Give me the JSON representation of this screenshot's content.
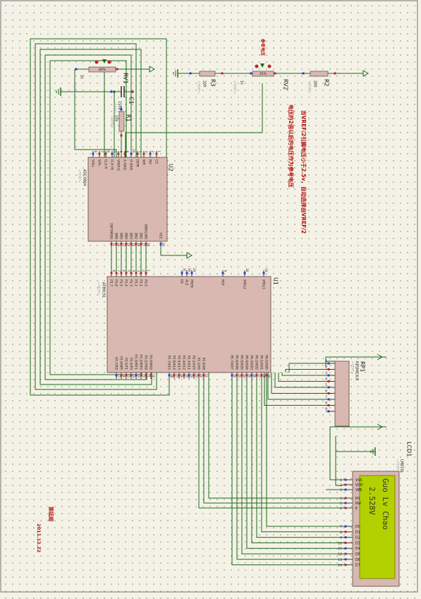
{
  "colors": {
    "wire": "#1a6b1a",
    "body": "#d8b8b0",
    "pin": "#c0242a",
    "pin_blue": "#2a3fd8",
    "text": "#1a1a1a",
    "grey": "#9a9a9a",
    "red_text": "#b01010",
    "lcd_bg": "#b3d000",
    "lcd_text": "#333333"
  },
  "u2": {
    "ref": "U2",
    "part": "ADC0804",
    "sub": "<TEXT>",
    "left_pins": [
      {
        "num": "6",
        "name": "VIN+"
      },
      {
        "num": "7",
        "name": "VIN-"
      },
      {
        "num": "19",
        "name": "CLK R"
      },
      {
        "num": "4",
        "name": "CLK IN"
      },
      {
        "num": "9",
        "name": "VREF/2"
      },
      {
        "num": "8",
        "name": "A GND"
      },
      {
        "num": "10",
        "name": "D GND"
      },
      {
        "num": "5",
        "name": "INTR"
      },
      {
        "num": "3",
        "name": "WR"
      },
      {
        "num": "2",
        "name": "RD"
      },
      {
        "num": "1",
        "name": "CS"
      }
    ],
    "right_pins": [
      {
        "num": "11",
        "name": "DB7(MSB)"
      },
      {
        "num": "12",
        "name": "DB6"
      },
      {
        "num": "13",
        "name": "DB5"
      },
      {
        "num": "14",
        "name": "DB4"
      },
      {
        "num": "15",
        "name": "DB3"
      },
      {
        "num": "16",
        "name": "DB2"
      },
      {
        "num": "17",
        "name": "DB1"
      },
      {
        "num": "18",
        "name": "DB0(LSB)"
      },
      {
        "num": "20",
        "name": "VCC"
      }
    ]
  },
  "u1": {
    "ref": "U1",
    "part": "AT89C51",
    "sub": "<TEXT>",
    "top_pins": [
      {
        "num": "8",
        "name": "P1.7"
      },
      {
        "num": "7",
        "name": "P1.6"
      },
      {
        "num": "6",
        "name": "P1.5"
      },
      {
        "num": "5",
        "name": "P1.4"
      },
      {
        "num": "4",
        "name": "P1.3"
      },
      {
        "num": "3",
        "name": "P1.2"
      },
      {
        "num": "2",
        "name": "P1.1"
      },
      {
        "num": "1",
        "name": "P1.0"
      },
      {
        "num": "31",
        "name": "EA"
      },
      {
        "num": "30",
        "name": "ALE"
      },
      {
        "num": "29",
        "name": "PSEN"
      },
      {
        "num": "9",
        "name": "RST"
      },
      {
        "num": "18",
        "name": "XTAL2"
      },
      {
        "num": "19",
        "name": "XTAL1"
      }
    ],
    "bottom_pins": [
      {
        "num": "17",
        "name": "P3.7/RD"
      },
      {
        "num": "16",
        "name": "P3.6/WR"
      },
      {
        "num": "15",
        "name": "P3.5/T1"
      },
      {
        "num": "14",
        "name": "P3.4/T0"
      },
      {
        "num": "13",
        "name": "P3.3/INT1"
      },
      {
        "num": "12",
        "name": "P3.2/INT0"
      },
      {
        "num": "11",
        "name": "P3.1/TXD"
      },
      {
        "num": "10",
        "name": "P3.0/RXD"
      },
      {
        "num": "28",
        "name": "P2.7/A15"
      },
      {
        "num": "27",
        "name": "P2.6/A14"
      },
      {
        "num": "26",
        "name": "P2.5/A13"
      },
      {
        "num": "25",
        "name": "P2.4/A12"
      },
      {
        "num": "24",
        "name": "P2.3/A11"
      },
      {
        "num": "23",
        "name": "P2.2/A10"
      },
      {
        "num": "22",
        "name": "P2.1/A9"
      },
      {
        "num": "21",
        "name": "P2.0/A8"
      },
      {
        "num": "32",
        "name": "P0.7/AD7"
      },
      {
        "num": "33",
        "name": "P0.6/AD6"
      },
      {
        "num": "34",
        "name": "P0.5/AD5"
      },
      {
        "num": "35",
        "name": "P0.4/AD4"
      },
      {
        "num": "36",
        "name": "P0.3/AD3"
      },
      {
        "num": "37",
        "name": "P0.2/AD2"
      },
      {
        "num": "38",
        "name": "P0.1/AD1"
      },
      {
        "num": "39",
        "name": "P0.0/AD0"
      }
    ]
  },
  "rp1": {
    "ref": "RP1",
    "part": "RESPACK-8",
    "sub": "<TEXT>",
    "pins": [
      "1",
      "2",
      "3",
      "4",
      "5",
      "6",
      "7",
      "8",
      "9"
    ]
  },
  "lcd1": {
    "ref": "LCD1",
    "part": "LM016L",
    "sub": "<TEXT>",
    "pins": [
      {
        "num": "1",
        "name": "VSS"
      },
      {
        "num": "2",
        "name": "VDD"
      },
      {
        "num": "3",
        "name": "VEE"
      },
      {
        "num": "4",
        "name": "RS"
      },
      {
        "num": "5",
        "name": "RW"
      },
      {
        "num": "6",
        "name": "E"
      },
      {
        "num": "7",
        "name": "D0"
      },
      {
        "num": "8",
        "name": "D1"
      },
      {
        "num": "9",
        "name": "D2"
      },
      {
        "num": "10",
        "name": "D3"
      },
      {
        "num": "11",
        "name": "D4"
      },
      {
        "num": "12",
        "name": "D5"
      },
      {
        "num": "13",
        "name": "D6"
      },
      {
        "num": "14",
        "name": "D7"
      }
    ],
    "line1": "Guo Lv Chao",
    "line2": "2.528V"
  },
  "rv1": {
    "ref": "RV1",
    "value": "1k",
    "sub": "<TEXT>",
    "percent": "80%"
  },
  "rv2": {
    "ref": "RV2",
    "value": "1k",
    "sub": "<TEXT>",
    "percent": "45%",
    "note": "参考电压"
  },
  "r1": {
    "ref": "R1",
    "value": "10k",
    "sub": "<TEXT>"
  },
  "r2": {
    "ref": "R2",
    "value": "200",
    "sub": "<TEXT>"
  },
  "r3": {
    "ref": "R3",
    "value": "200",
    "sub": "<TEXT>"
  },
  "c1": {
    "ref": "C1",
    "value": "150p",
    "sub": "<TEXT>"
  },
  "notes": {
    "line1": "当VREF/2引脚电压小于2.5v，自动选择由VREF/2",
    "line2": "电压的2倍以后的电压作为参考电压",
    "author": "郭廷超",
    "date": "2011.12.22"
  }
}
